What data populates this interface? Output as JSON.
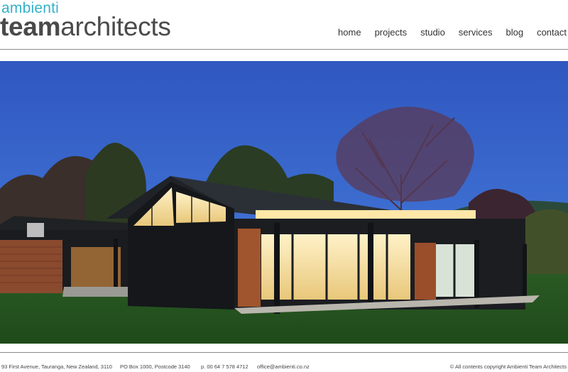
{
  "logo": {
    "top": "ambienti",
    "main_bold": "team",
    "main_rest": "architects"
  },
  "nav": {
    "items": [
      "home",
      "projects",
      "studio",
      "services",
      "blog",
      "contact"
    ]
  },
  "footer": {
    "address": "93 First Avenue, Tauranga, New Zealand, 3110",
    "po_box": "PO Box 1000, Postcode 3140",
    "phone": "p. 00 64 7 578 4712",
    "email": "office@ambienti.co.nz",
    "copyright": "© All contents copyright Ambienti Team Architects"
  },
  "colors": {
    "brand_teal": "#35b1c9",
    "sky": "#3a63c2",
    "grass": "#2f5e28"
  }
}
